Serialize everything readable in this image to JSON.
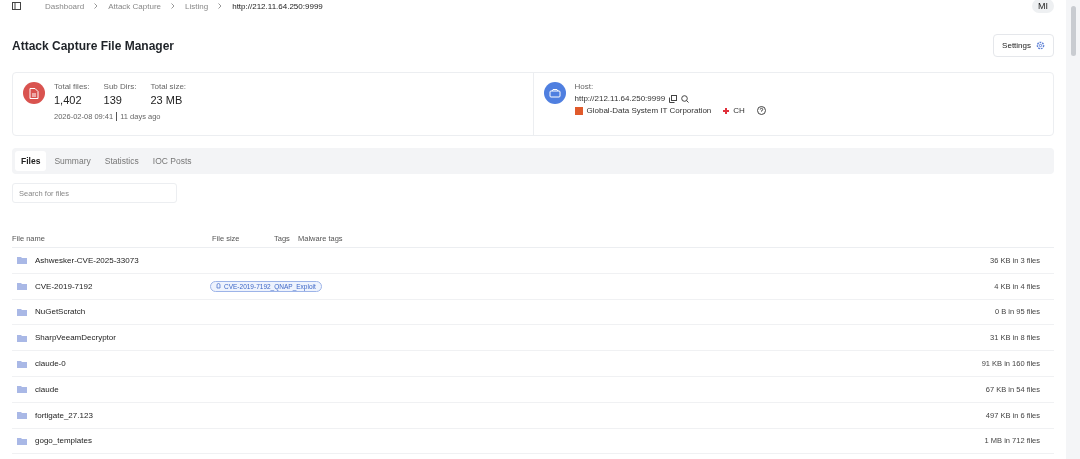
{
  "breadcrumb": [
    "Dashboard",
    "Attack Capture",
    "Listing",
    "http://212.11.64.250:9999"
  ],
  "user": {
    "initials": "MI"
  },
  "title": "Attack Capture File Manager",
  "settings_button": "Settings",
  "stats": [
    {
      "label": "Total files:",
      "value": "1,402"
    },
    {
      "label": "Sub Dirs:",
      "value": "139"
    },
    {
      "label": "Total size:",
      "value": "23 MB"
    }
  ],
  "timestamp": "2026-02-08 09:41",
  "relative_time": "11 days ago",
  "host": {
    "label": "Host:",
    "url": "http://212.11.64.250:9999",
    "org": "Global-Data System IT Corporation",
    "country": "CH"
  },
  "tabs": [
    {
      "label": "Files",
      "selected": true
    },
    {
      "label": "Summary",
      "selected": false
    },
    {
      "label": "Statistics",
      "selected": false
    },
    {
      "label": "IOC Posts",
      "selected": false
    }
  ],
  "search": {
    "placeholder": "Search for files"
  },
  "columns": [
    "File name",
    "File size",
    "Tags",
    "Malware tags"
  ],
  "rows": [
    {
      "name": "Ashwesker-CVE-2025-33073",
      "size": "36 KB in 3 files"
    },
    {
      "name": "CVE-2019-7192",
      "tag": "CVE-2019-7192_QNAP_Exploit",
      "size": "4 KB in 4 files"
    },
    {
      "name": "NuGetScratch",
      "size": "0 B in 95 files"
    },
    {
      "name": "SharpVeeamDecryptor",
      "size": "31 KB in 8 files"
    },
    {
      "name": "claude-0",
      "size": "91 KB in 160 files"
    },
    {
      "name": "claude",
      "size": "67 KB in 54 files"
    },
    {
      "name": "fortigate_27.123",
      "size": "497 KB in 6 files"
    },
    {
      "name": "gogo_templates",
      "size": "1 MB in 712 files"
    }
  ]
}
